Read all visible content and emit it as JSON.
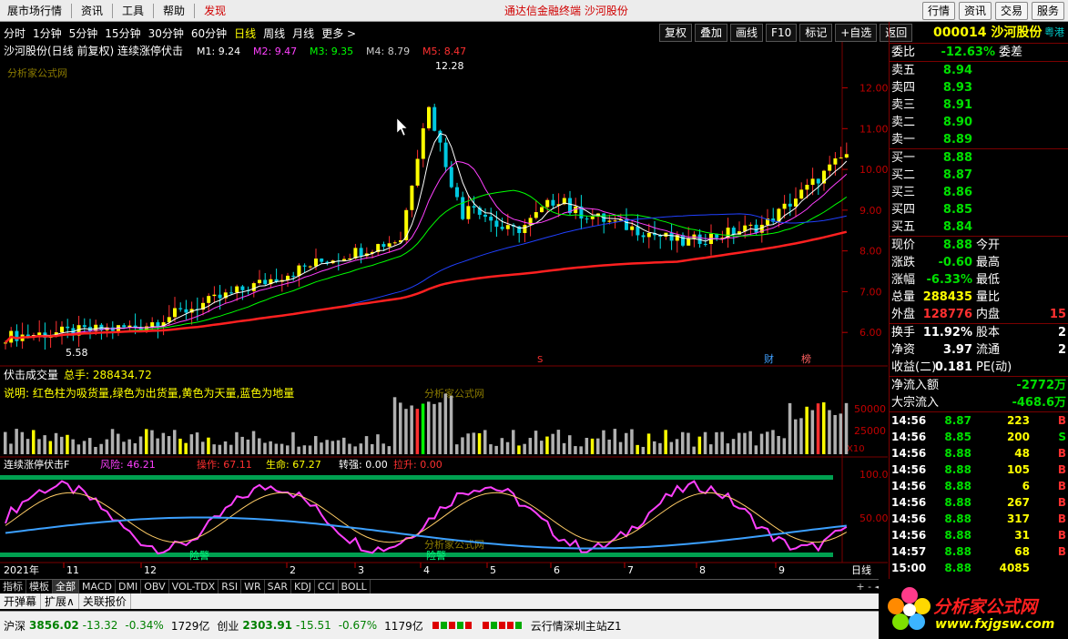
{
  "menu": {
    "items": [
      "展市场行情",
      "资讯",
      "工具",
      "帮助"
    ],
    "discover": "发现",
    "center_title": "通达信金融终端   沙河股份",
    "right_buttons": [
      "行情",
      "资讯",
      "交易",
      "服务"
    ]
  },
  "periods": {
    "items": [
      "分时",
      "1分钟",
      "5分钟",
      "15分钟",
      "30分钟",
      "60分钟",
      "日线",
      "周线",
      "月线",
      "更多 >"
    ],
    "active": "日线"
  },
  "tools": [
    "复权",
    "叠加",
    "画线",
    "F10",
    "标记",
    "+自选",
    "返回"
  ],
  "main_chart": {
    "title": "沙河股份(日线 前复权) 连续涨停伏击",
    "ma": [
      {
        "label": "M1: 9.24",
        "color": "#ffffff"
      },
      {
        "label": "M2: 9.47",
        "color": "#ff40ff"
      },
      {
        "label": "M3: 9.35",
        "color": "#00ff00"
      },
      {
        "label": "M4: 8.79",
        "color": "#cccccc"
      },
      {
        "label": "M5: 8.47",
        "color": "#ff3030"
      }
    ],
    "high_label": "12.28",
    "low_label": "5.58",
    "price_ticks": [
      "12.00",
      "11.00",
      "10.00",
      "9.00",
      "8.00",
      "7.00",
      "6.00"
    ],
    "watermark": "分析家公式网",
    "badges": [
      "财",
      "榜"
    ],
    "s_mark": "S"
  },
  "volume_chart": {
    "title": "伏击成交量",
    "total": "总手: 288434.72",
    "desc": "说明: 红色柱为吸货量,绿色为出货量,黄色为天量,蓝色为地量",
    "ticks": [
      "50000",
      "25000"
    ],
    "unit": "X10",
    "watermark": "分析家公式网"
  },
  "ind_chart": {
    "title": "连续涨停伏击F",
    "risk": "风险: 46.21",
    "op": "操作: 67.11",
    "life": "生命: 67.27",
    "strong": "转强: 0.00",
    "pull": "拉升: 0.00",
    "ticks": [
      "100.0",
      "50.00"
    ],
    "warn": "险警",
    "watermark": "分析家公式网"
  },
  "date_axis": {
    "year": "2021年",
    "months": [
      "11",
      "12",
      "2",
      "3",
      "4",
      "5",
      "6",
      "7",
      "8",
      "9"
    ],
    "period_label": "日线"
  },
  "quote": {
    "code": "000014",
    "name": "沙河股份",
    "vtag": "粤港",
    "weibi_label": "委比",
    "weibi": "-12.63%",
    "weicha_label": "委差",
    "asks": [
      {
        "label": "卖五",
        "price": "8.94"
      },
      {
        "label": "卖四",
        "price": "8.93"
      },
      {
        "label": "卖三",
        "price": "8.91"
      },
      {
        "label": "卖二",
        "price": "8.90"
      },
      {
        "label": "卖一",
        "price": "8.89"
      }
    ],
    "bids": [
      {
        "label": "买一",
        "price": "8.88"
      },
      {
        "label": "买二",
        "price": "8.87"
      },
      {
        "label": "买三",
        "price": "8.86"
      },
      {
        "label": "买四",
        "price": "8.85"
      },
      {
        "label": "买五",
        "price": "8.84"
      }
    ],
    "stats": [
      {
        "label": "现价",
        "value": "8.88",
        "cls": "g",
        "label2": "今开",
        "value2": ""
      },
      {
        "label": "涨跌",
        "value": "-0.60",
        "cls": "g",
        "label2": "最高",
        "value2": ""
      },
      {
        "label": "涨幅",
        "value": "-6.33%",
        "cls": "g",
        "label2": "最低",
        "value2": ""
      },
      {
        "label": "总量",
        "value": "288435",
        "cls": "y",
        "label2": "量比",
        "value2": ""
      },
      {
        "label": "外盘",
        "value": "128776",
        "cls": "r",
        "label2": "内盘",
        "value2": "15"
      }
    ],
    "stats2": [
      {
        "label": "换手",
        "value": "11.92%",
        "cls": "w",
        "label2": "股本",
        "value2": "2"
      },
      {
        "label": "净资",
        "value": "3.97",
        "cls": "w",
        "label2": "流通",
        "value2": "2"
      },
      {
        "label": "收益(二)",
        "value": "0.181",
        "cls": "w",
        "label2": "PE(动)",
        "value2": ""
      }
    ],
    "flows": [
      {
        "label": "净流入额",
        "value": "-2772万"
      },
      {
        "label": "大宗流入",
        "value": "-468.6万"
      }
    ],
    "ticks": [
      {
        "time": "14:56",
        "price": "8.87",
        "vol": "223",
        "bs": "B",
        "bscls": "r"
      },
      {
        "time": "14:56",
        "price": "8.85",
        "vol": "200",
        "bs": "S",
        "bscls": "g"
      },
      {
        "time": "14:56",
        "price": "8.88",
        "vol": "48",
        "bs": "B",
        "bscls": "r"
      },
      {
        "time": "14:56",
        "price": "8.88",
        "vol": "105",
        "bs": "B",
        "bscls": "r"
      },
      {
        "time": "14:56",
        "price": "8.88",
        "vol": "6",
        "bs": "B",
        "bscls": "r"
      },
      {
        "time": "14:56",
        "price": "8.88",
        "vol": "267",
        "bs": "B",
        "bscls": "r"
      },
      {
        "time": "14:56",
        "price": "8.88",
        "vol": "317",
        "bs": "B",
        "bscls": "r"
      },
      {
        "time": "14:56",
        "price": "8.88",
        "vol": "31",
        "bs": "B",
        "bscls": "r"
      },
      {
        "time": "14:57",
        "price": "8.88",
        "vol": "68",
        "bs": "B",
        "bscls": "r"
      },
      {
        "time": "15:00",
        "price": "8.88",
        "vol": "4085",
        "bs": "",
        "bscls": "r"
      }
    ]
  },
  "tabs": {
    "items": [
      "指标",
      "模板",
      "全部",
      "MACD",
      "DMI",
      "OBV",
      "VOL-TDX",
      "RSI",
      "WR",
      "SAR",
      "KDJ",
      "CCI",
      "BOLL"
    ],
    "active": "全部",
    "nav": "+  -  ◄"
  },
  "subtabs": [
    "开弹幕",
    "扩展∧",
    "关联报价"
  ],
  "status": {
    "sh_label": "沪深",
    "sh_value": "3856.02",
    "sh_change": "-13.32",
    "sh_pct": "-0.34%",
    "sh_amount": "1729亿",
    "cy_label": "创业",
    "cy_value": "2303.91",
    "cy_change": "-15.51",
    "cy_pct": "-0.67%",
    "cy_amount": "1179亿",
    "server": "云行情深圳主站Z1"
  },
  "logo": {
    "text": "分析家公式网",
    "url": "www.fxjgsw.com"
  },
  "colors": {
    "up": "#ff3030",
    "down": "#00e000",
    "grid": "#7a0000",
    "accent": "#ffff00"
  }
}
